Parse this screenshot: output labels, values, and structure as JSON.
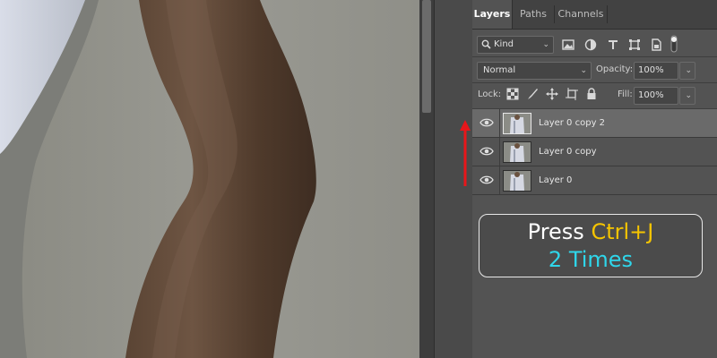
{
  "panel": {
    "tabs": [
      {
        "label": "Layers",
        "active": true
      },
      {
        "label": "Paths",
        "active": false
      },
      {
        "label": "Channels",
        "active": false
      }
    ],
    "filter": {
      "value": "Kind",
      "icons": [
        "image-filter-icon",
        "adjustment-filter-icon",
        "type-filter-icon",
        "shape-filter-icon",
        "smart-object-filter-icon",
        "filter-toggle-icon"
      ]
    },
    "blend_mode": {
      "value": "Normal"
    },
    "opacity": {
      "label": "Opacity:",
      "value": "100%"
    },
    "lock": {
      "label": "Lock:",
      "icons": [
        "lock-transparent-pixels-icon",
        "lock-image-pixels-icon",
        "lock-position-icon",
        "lock-artboard-icon",
        "lock-all-icon"
      ]
    },
    "fill": {
      "label": "Fill:",
      "value": "100%"
    },
    "layers": [
      {
        "name": "Layer 0 copy 2",
        "selected": true,
        "visible": true
      },
      {
        "name": "Layer 0 copy",
        "selected": false,
        "visible": true
      },
      {
        "name": "Layer 0",
        "selected": false,
        "visible": true
      }
    ]
  },
  "callout": {
    "press": "Press",
    "shortcut": "Ctrl+J",
    "times": "2 Times",
    "colors": {
      "shortcut": "#f5c400",
      "times": "#2fd6ea"
    }
  },
  "arrow_color": "#e8161a"
}
